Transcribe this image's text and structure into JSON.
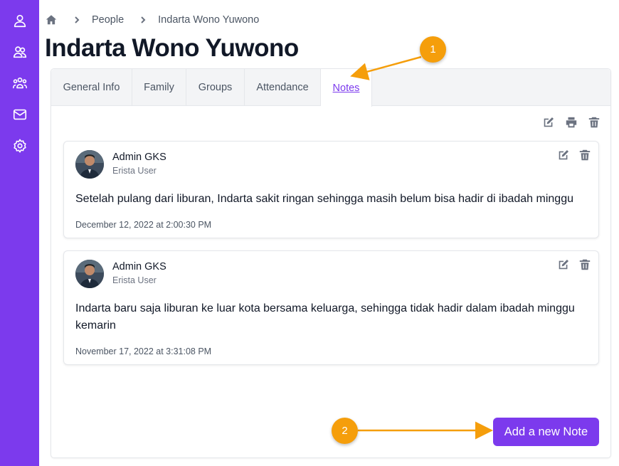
{
  "breadcrumb": {
    "home_icon": "home-icon",
    "items": [
      "People",
      "Indarta Wono Yuwono"
    ]
  },
  "page": {
    "title": "Indarta Wono Yuwono"
  },
  "tabs": [
    {
      "label": "General Info"
    },
    {
      "label": "Family"
    },
    {
      "label": "Groups"
    },
    {
      "label": "Attendance"
    },
    {
      "label": "Notes",
      "active": true
    }
  ],
  "toolbar": {
    "icons": [
      "edit-icon",
      "print-icon",
      "trash-icon"
    ]
  },
  "notes": [
    {
      "author": "Admin GKS",
      "role": "Erista User",
      "body": "Setelah pulang dari liburan, Indarta sakit ringan sehingga masih belum bisa hadir di ibadah minggu",
      "date": "December 12, 2022 at 2:00:30 PM"
    },
    {
      "author": "Admin GKS",
      "role": "Erista User",
      "body": "Indarta baru saja liburan ke luar kota bersama keluarga, sehingga tidak hadir dalam ibadah minggu kemarin",
      "date": "November 17, 2022 at 3:31:08 PM"
    }
  ],
  "add_note_button": "Add a new Note",
  "callouts": [
    "1",
    "2"
  ],
  "colors": {
    "sidebar": "#7c3aed",
    "accent": "#7c3aed",
    "callout": "#f59e0b"
  }
}
